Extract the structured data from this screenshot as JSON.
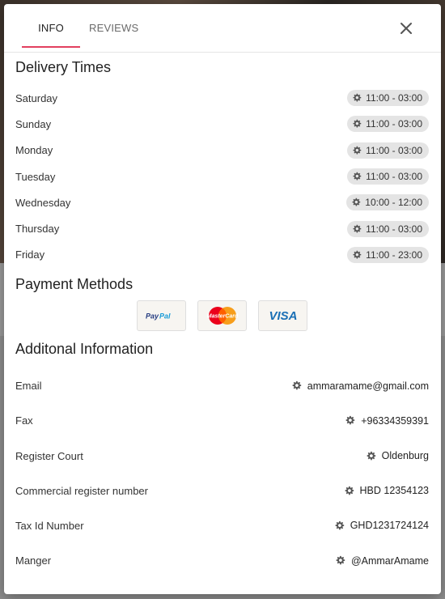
{
  "colors": {
    "accent": "#e2405f",
    "pill_bg": "#e4e4e4",
    "icon": "#555555"
  },
  "tabs": [
    {
      "label": "INFO",
      "active": true
    },
    {
      "label": "REVIEWS",
      "active": false
    }
  ],
  "icons": {
    "close": "close-icon",
    "gear": "gear-icon"
  },
  "delivery": {
    "title": "Delivery Times",
    "days": [
      {
        "day": "Saturday",
        "hours": "11:00 - 03:00"
      },
      {
        "day": "Sunday",
        "hours": "11:00 - 03:00"
      },
      {
        "day": "Monday",
        "hours": "11:00 - 03:00"
      },
      {
        "day": "Tuesday",
        "hours": "11:00 - 03:00"
      },
      {
        "day": "Wednesday",
        "hours": "10:00 - 12:00"
      },
      {
        "day": "Thursday",
        "hours": "11:00 - 03:00"
      },
      {
        "day": "Friday",
        "hours": "11:00 - 23:00"
      }
    ]
  },
  "payment": {
    "title": "Payment Methods",
    "methods": [
      {
        "name": "PayPal",
        "icon": "paypal-logo"
      },
      {
        "name": "MasterCard",
        "icon": "mastercard-logo"
      },
      {
        "name": "VISA",
        "icon": "visa-logo"
      }
    ]
  },
  "additional": {
    "title": "Additonal Information",
    "items": [
      {
        "label": "Email",
        "value": "ammaramame@gmail.com"
      },
      {
        "label": "Fax",
        "value": "+96334359391"
      },
      {
        "label": "Register Court",
        "value": "Oldenburg"
      },
      {
        "label": "Commercial register number",
        "value": "HBD 12354123"
      },
      {
        "label": "Tax Id Number",
        "value": "GHD1231724124"
      },
      {
        "label": "Manger",
        "value": "@AmmarAmame"
      }
    ]
  }
}
